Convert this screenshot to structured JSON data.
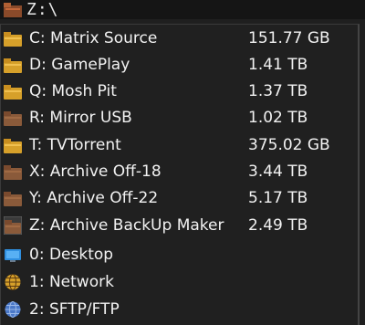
{
  "window": {
    "path": "Z:\\"
  },
  "drives": [
    {
      "name": "C: Matrix Source",
      "size": "151.77 GB",
      "icon": "drive-folder-icon",
      "color": "#d6a02a"
    },
    {
      "name": "D: GamePlay",
      "size": "1.41 TB",
      "icon": "drive-folder-icon",
      "color": "#d6a02a"
    },
    {
      "name": "Q: Mosh Pit",
      "size": "1.37 TB",
      "icon": "drive-folder-icon",
      "color": "#d6a02a"
    },
    {
      "name": "R: Mirror USB",
      "size": "1.02 TB",
      "icon": "drive-folder-icon",
      "color": "#8a5a3a"
    },
    {
      "name": "T: TVTorrent",
      "size": "375.02 GB",
      "icon": "drive-folder-icon",
      "color": "#d6a02a"
    },
    {
      "name": "X: Archive Off-18",
      "size": "3.44 TB",
      "icon": "drive-folder-icon",
      "color": "#8a5a3a"
    },
    {
      "name": "Y: Archive Off-22",
      "size": "5.17 TB",
      "icon": "drive-folder-icon",
      "color": "#8a5a3a"
    },
    {
      "name": "Z: Archive BackUp Maker",
      "size": "2.49 TB",
      "icon": "drive-folder-icon",
      "color": "#8a5a3a"
    },
    {
      "name": "0: Desktop",
      "size": "",
      "icon": "desktop-icon",
      "color": "#2f8fe0"
    },
    {
      "name": "1: Network",
      "size": "",
      "icon": "network-globe-icon",
      "color": "#d6a02a"
    },
    {
      "name": "2: SFTP/FTP",
      "size": "",
      "icon": "sftp-globe-icon",
      "color": "#4a78c8"
    }
  ]
}
